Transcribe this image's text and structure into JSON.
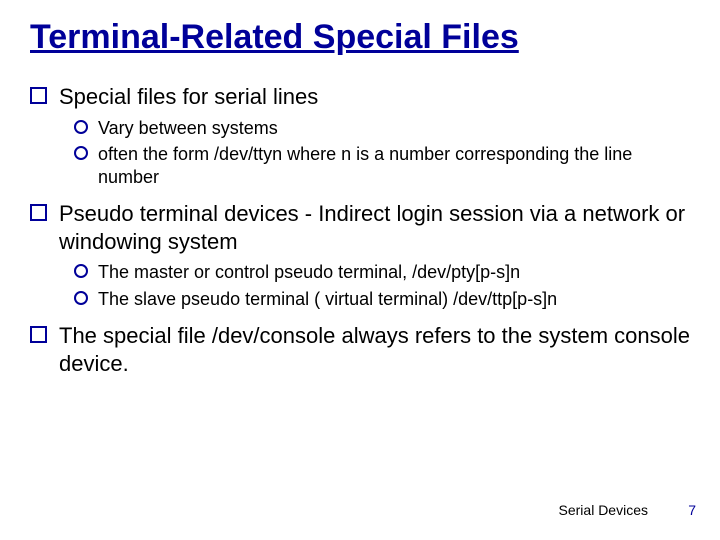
{
  "title": "Terminal-Related Special Files",
  "points": [
    {
      "text": "Special files for serial lines",
      "sub": [
        "Vary between systems",
        "often the form /dev/ttyn where n is a number corresponding the line number"
      ]
    },
    {
      "text": "Pseudo terminal devices - Indirect login session via a network or windowing system",
      "sub": [
        "The master or control pseudo terminal, /dev/pty[p-s]n",
        "The slave pseudo terminal ( virtual terminal) /dev/ttp[p-s]n"
      ]
    },
    {
      "text": "The special file /dev/console always refers to the system console device.",
      "sub": []
    }
  ],
  "footer": "Serial Devices",
  "page": "7"
}
